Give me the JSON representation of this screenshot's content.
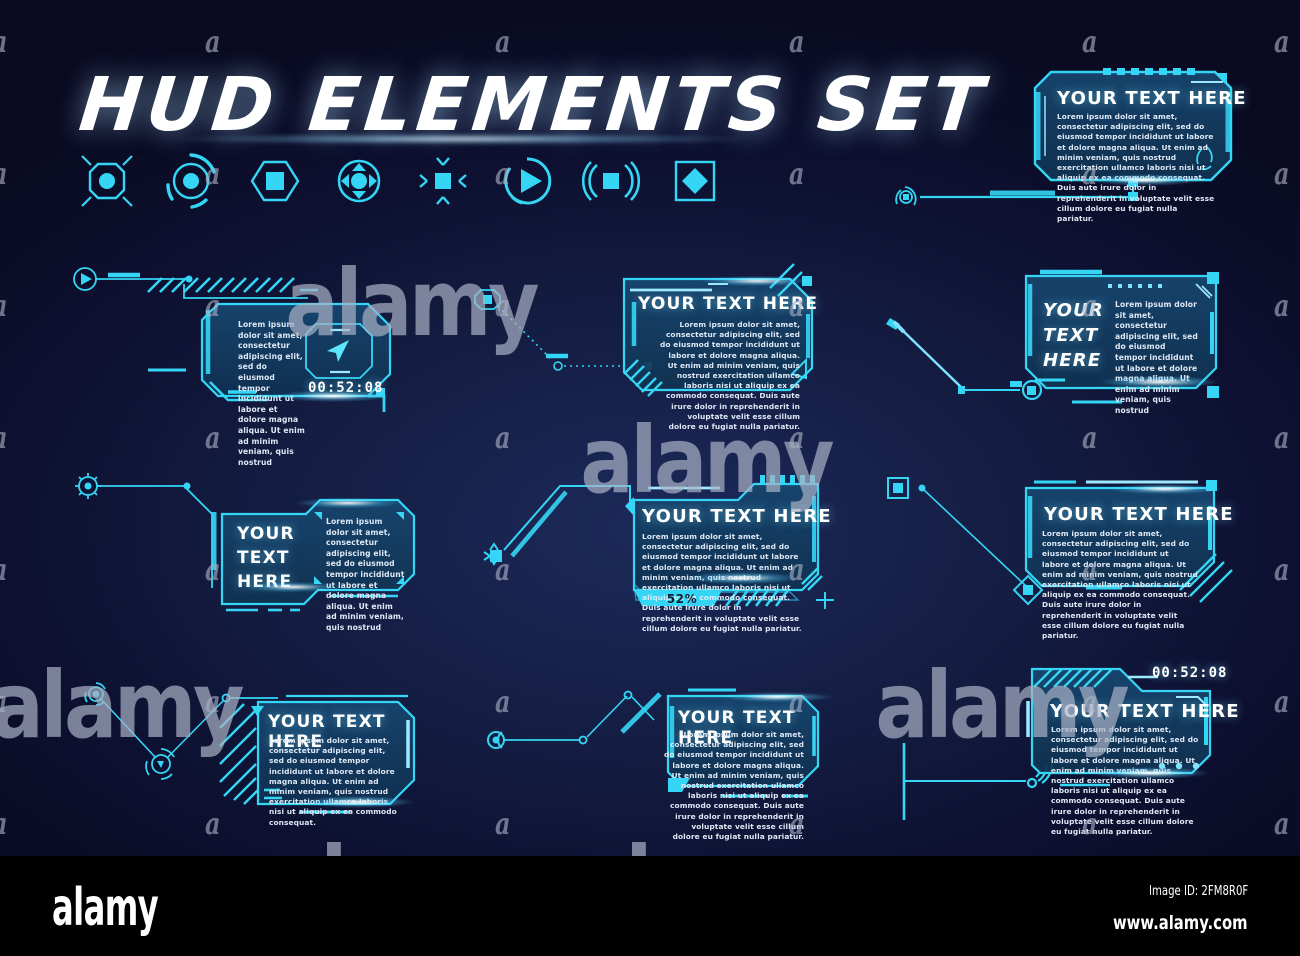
{
  "meta": {
    "title": "HUD ELEMENTS SET",
    "accent": "#35d6f5",
    "accent_dark": "#1a9fc4",
    "panel_fill_top": "#14406b",
    "panel_fill_bottom": "#123a60",
    "background": "#101538",
    "text_color": "#ffffff"
  },
  "header": {
    "title": "HUD ELEMENTS SET"
  },
  "icons": [
    {
      "name": "octagon-target-icon"
    },
    {
      "name": "radar-circle-icon"
    },
    {
      "name": "hexagon-square-icon"
    },
    {
      "name": "circle-quad-arrow-icon"
    },
    {
      "name": "crosshair-square-icon"
    },
    {
      "name": "play-circle-icon"
    },
    {
      "name": "signal-square-icon"
    },
    {
      "name": "diamond-square-icon"
    }
  ],
  "lorem": {
    "full": "Lorem ipsum dolor sit amet, consectetur adipiscing elit, sed do eiusmod tempor incididunt ut labore et dolore magna aliqua. Ut enim ad minim veniam, quis nostrud exercitation ullamco laboris nisi ut aliquip ex ea commodo consequat. Duis aute irure dolor in reprehenderit in voluptate velit esse cillum dolore eu fugiat nulla pariatur.",
    "short": "Lorem ipsum dolor sit amet, consectetur adipiscing elit, sed do eiusmod tempor incididunt ut labore et dolore magna aliqua. Ut enim ad minim veniam, quis nostrud",
    "medium": "Lorem ipsum dolor sit amet, consectetur adipiscing elit, sed do eiusmod tempor incididunt ut labore et dolore magna aliqua. Ut enim ad minim veniam, quis nostrud exercitation ullamco laboris nisi ut aliquip ex ea commodo consequat."
  },
  "panels": [
    {
      "id": "panel-top-right",
      "heading": "YOUR TEXT HERE",
      "body": "Lorem ipsum dolor sit amet, consectetur adipiscing elit, sed do eiusmod tempor incididunt ut labore et dolore magna aliqua. Ut enim ad minim veniam, quis nostrud exercitation ullamco laboris nisi ut aliquip ex ea commodo consequat. Duis aute irure dolor in reprehenderit in voluptate velit esse cillum dolore eu fugiat nulla pariatur."
    },
    {
      "id": "panel-r2-left",
      "body": "Lorem ipsum dolor sit amet, consectetur adipiscing elit, sed do eiusmod tempor incididunt ut labore et dolore magna aliqua. Ut enim ad minim veniam, quis nostrud",
      "timer": "00:52:08"
    },
    {
      "id": "panel-r2-mid",
      "heading": "YOUR TEXT HERE",
      "body": "Lorem ipsum dolor sit amet, consectetur adipiscing elit, sed do eiusmod tempor incididunt ut labore et dolore magna aliqua. Ut enim ad minim veniam, quis nostrud exercitation ullamco laboris nisi ut aliquip ex ea commodo consequat. Duis aute irure dolor in reprehenderit in voluptate velit esse cillum dolore eu fugiat nulla pariatur."
    },
    {
      "id": "panel-r2-right",
      "heading_line1": "YOUR",
      "heading_line2": "TEXT",
      "heading_line3": "HERE",
      "body": "Lorem ipsum dolor sit amet, consectetur adipiscing elit, sed do eiusmod tempor incididunt ut labore et dolore magna aliqua. Ut enim ad minim veniam, quis nostrud"
    },
    {
      "id": "panel-r3-left",
      "heading_line1": "YOUR",
      "heading_line2": "TEXT",
      "heading_line3": "HERE",
      "body": "Lorem ipsum dolor sit amet, consectetur adipiscing elit, sed do eiusmod tempor incididunt ut labore et dolore magna aliqua. Ut enim ad minim veniam, quis nostrud"
    },
    {
      "id": "panel-r3-mid",
      "heading": "YOUR TEXT HERE",
      "body": "Lorem ipsum dolor sit amet, consectetur adipiscing elit, sed do eiusmod tempor incididunt ut labore et dolore magna aliqua. Ut enim ad minim veniam, quis nostrud exercitation ullamco laboris nisi ut aliquip ex ea commodo consequat. Duis aute irure dolor in reprehenderit in voluptate velit esse cillum dolore eu fugiat nulla pariatur.",
      "progress_label": "52%",
      "progress_value": 52
    },
    {
      "id": "panel-r3-right",
      "heading": "YOUR TEXT HERE",
      "body": "Lorem ipsum dolor sit amet, consectetur adipiscing elit, sed do eiusmod tempor incididunt ut labore et dolore magna aliqua. Ut enim ad minim veniam, quis nostrud exercitation ullamco laboris nisi ut aliquip ex ea commodo consequat. Duis aute irure dolor in reprehenderit in voluptate velit esse cillum dolore eu fugiat nulla pariatur."
    },
    {
      "id": "panel-r4-left",
      "heading": "YOUR TEXT HERE",
      "body": "Lorem ipsum dolor sit amet, consectetur adipiscing elit, sed do eiusmod tempor incididunt ut labore et dolore magna aliqua. Ut enim ad minim veniam, quis nostrud exercitation ullamco laboris nisi ut aliquip ex ea commodo consequat."
    },
    {
      "id": "panel-r4-mid",
      "heading": "YOUR TEXT HERE",
      "body": "Lorem ipsum dolor sit amet, consectetur adipiscing elit, sed do eiusmod tempor incididunt ut labore et dolore magna aliqua. Ut enim ad minim veniam, quis nostrud exercitation ullamco laboris nisi ut aliquip ex ea commodo consequat. Duis aute irure dolor in reprehenderit in voluptate velit esse cillum dolore eu fugiat nulla pariatur."
    },
    {
      "id": "panel-r4-right",
      "heading": "YOUR TEXT HERE",
      "body": "Lorem ipsum dolor sit amet, consectetur adipiscing elit, sed do eiusmod tempor incididunt ut labore et dolore magna aliqua. Ut enim ad minim veniam, quis nostrud exercitation ullamco laboris nisi ut aliquip ex ea commodo consequat. Duis aute irure dolor in reprehenderit in voluptate velit esse cillum dolore eu fugiat nulla pariatur.",
      "timer": "00:52:08"
    }
  ],
  "watermark": {
    "glyph": "a",
    "logo": "alamy"
  },
  "footer": {
    "logo": "alamy",
    "image_id": "Image ID: 2FM8R0F",
    "url": "www.alamy.com"
  }
}
